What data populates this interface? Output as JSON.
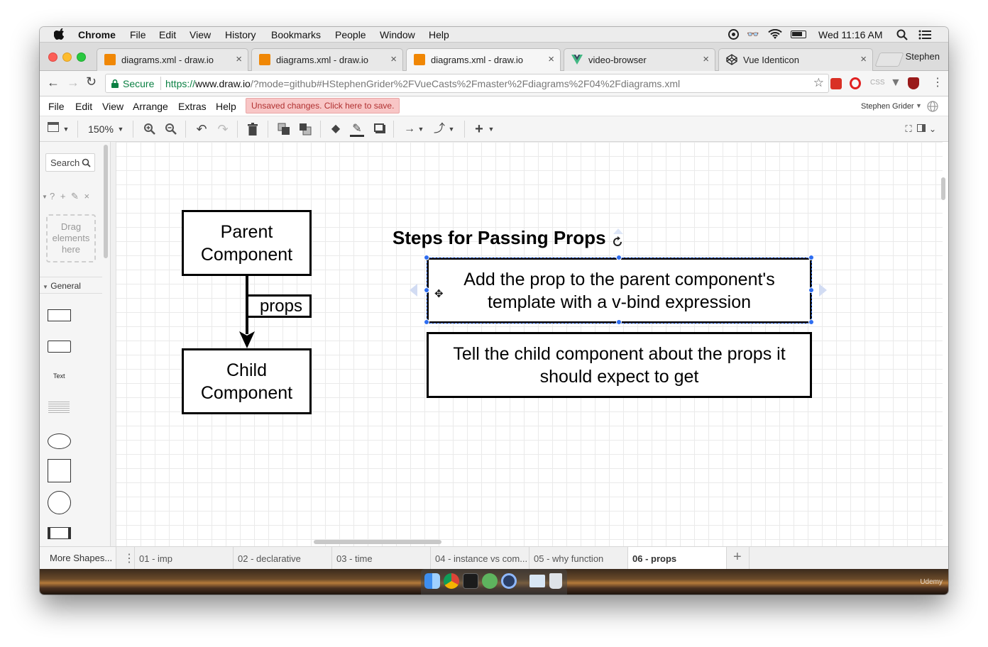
{
  "menubar": {
    "app": "Chrome",
    "items": [
      "File",
      "Edit",
      "View",
      "History",
      "Bookmarks",
      "People",
      "Window",
      "Help"
    ],
    "clock": "Wed 11:16 AM"
  },
  "tabs": [
    {
      "title": "diagrams.xml - draw.io",
      "icon": "drawio-icon",
      "active": false
    },
    {
      "title": "diagrams.xml - draw.io",
      "icon": "drawio-icon",
      "active": false
    },
    {
      "title": "diagrams.xml - draw.io",
      "icon": "drawio-icon",
      "active": true
    },
    {
      "title": "video-browser",
      "icon": "vue-icon",
      "active": false
    },
    {
      "title": "Vue Identicon",
      "icon": "codepen-icon",
      "active": false
    }
  ],
  "profile": "Stephen",
  "address": {
    "secure_label": "Secure",
    "url_prefix": "https://",
    "url_host": "www.draw.io",
    "url_path": "/?mode=github#HStephenGrider%2FVueCasts%2Fmaster%2Fdiagrams%2F04%2Fdiagrams.xml"
  },
  "drawio_menu": {
    "items": [
      "File",
      "Edit",
      "View",
      "Arrange",
      "Extras",
      "Help"
    ],
    "unsaved_notice": "Unsaved changes. Click here to save.",
    "user": "Stephen Grider"
  },
  "drawio_toolbar": {
    "zoom": "150%"
  },
  "sidebar": {
    "search_label": "Search",
    "scratch_header": "? + ✎ ×",
    "drag_hint": "Drag elements here",
    "section": "General",
    "text_shape": "Text",
    "more_shapes": "More Shapes..."
  },
  "diagram": {
    "parent_box": "Parent Component",
    "props_label": "props",
    "child_box": "Child Component",
    "steps_title": "Steps for Passing Props",
    "step1": "Add the prop to the parent component's template with a v-bind expression",
    "step2": "Tell the child component about the props it should expect to get"
  },
  "pages": [
    "01 - imp",
    "02 - declarative",
    "03 - time",
    "04 - instance vs com...",
    "05 - why function",
    "06 - props"
  ],
  "active_page": "06 - props",
  "dock": {
    "watermark": "Udemy"
  },
  "colors": {
    "drawio_orange": "#f08705",
    "unsaved_bg": "#f8c6c6",
    "selection_blue": "#2e6df0",
    "vue_green": "#42b883"
  }
}
